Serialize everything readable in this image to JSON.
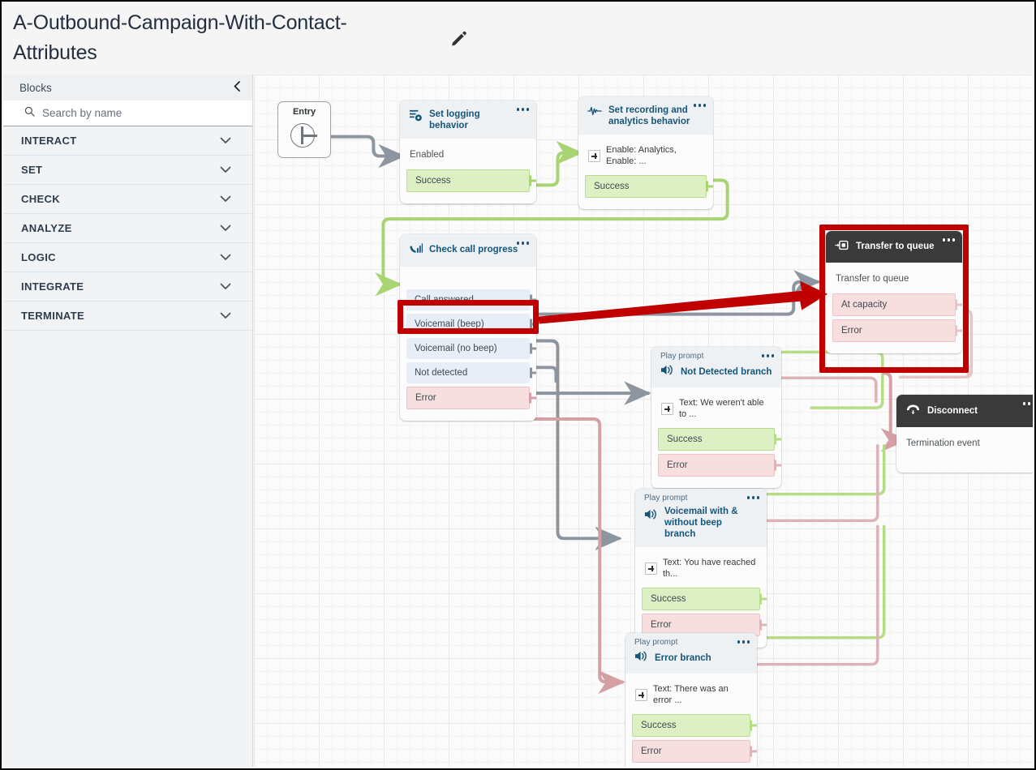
{
  "header": {
    "title": "A-Outbound-Campaign-With-Contact-Attributes",
    "edit_icon": "pencil-icon"
  },
  "sidebar": {
    "panel_title": "Blocks",
    "collapse_icon": "chevron-left-icon",
    "search": {
      "placeholder": "Search by name",
      "icon": "search-icon",
      "value": ""
    },
    "categories": [
      {
        "label": "INTERACT",
        "icon": "chevron-down-icon"
      },
      {
        "label": "SET",
        "icon": "chevron-down-icon"
      },
      {
        "label": "CHECK",
        "icon": "chevron-down-icon"
      },
      {
        "label": "ANALYZE",
        "icon": "chevron-down-icon"
      },
      {
        "label": "LOGIC",
        "icon": "chevron-down-icon"
      },
      {
        "label": "INTEGRATE",
        "icon": "chevron-down-icon"
      },
      {
        "label": "TERMINATE",
        "icon": "chevron-down-icon"
      }
    ]
  },
  "canvas": {
    "entry": {
      "label": "Entry"
    },
    "blocks": {
      "set_logging": {
        "title": "Set logging behavior",
        "icon": "log-settings-icon",
        "menu_icon": "more-options-icon",
        "input_label": "Enabled",
        "ports": [
          {
            "label": "Success",
            "type": "green"
          }
        ]
      },
      "set_recording": {
        "title": "Set recording and analytics behavior",
        "icon": "waveform-icon",
        "menu_icon": "more-options-icon",
        "param_label": "Enable: Analytics, Enable: ...",
        "ports": [
          {
            "label": "Success",
            "type": "green"
          }
        ]
      },
      "check_call_progress": {
        "title": "Check call progress",
        "icon": "call-progress-icon",
        "menu_icon": "more-options-icon",
        "ports": [
          {
            "label": "Call answered",
            "type": "blue"
          },
          {
            "label": "Voicemail (beep)",
            "type": "blue"
          },
          {
            "label": "Voicemail (no beep)",
            "type": "blue"
          },
          {
            "label": "Not detected",
            "type": "blue"
          },
          {
            "label": "Error",
            "type": "red"
          }
        ]
      },
      "transfer_to_queue": {
        "title": "Transfer to queue",
        "icon": "transfer-queue-icon",
        "menu_icon": "more-options-icon",
        "input_label": "Transfer to queue",
        "ports": [
          {
            "label": "At capacity",
            "type": "red"
          },
          {
            "label": "Error",
            "type": "red"
          }
        ]
      },
      "not_detected_branch": {
        "subtitle": "Play prompt",
        "title": "Not Detected branch",
        "icon": "speaker-icon",
        "menu_icon": "more-options-icon",
        "param_label": "Text: We weren't able to ...",
        "ports": [
          {
            "label": "Success",
            "type": "green"
          },
          {
            "label": "Error",
            "type": "red"
          }
        ]
      },
      "voicemail_branch": {
        "subtitle": "Play prompt",
        "title": "Voicemail with & without beep branch",
        "icon": "speaker-icon",
        "menu_icon": "more-options-icon",
        "param_label": "Text: You have reached th...",
        "ports": [
          {
            "label": "Success",
            "type": "green"
          },
          {
            "label": "Error",
            "type": "red"
          }
        ]
      },
      "error_branch": {
        "subtitle": "Play prompt",
        "title": "Error branch",
        "icon": "speaker-icon",
        "menu_icon": "more-options-icon",
        "param_label": "Text: There was an error ...",
        "ports": [
          {
            "label": "Success",
            "type": "green"
          },
          {
            "label": "Error",
            "type": "red"
          }
        ]
      },
      "disconnect": {
        "title": "Disconnect",
        "icon": "hangup-icon",
        "menu_icon": "more-options-icon",
        "input_label": "Termination event"
      }
    },
    "annotations": {
      "highlight_color": "#c00000",
      "highlighted": [
        "Call answered",
        "Transfer to queue"
      ],
      "arrow": "call-answered-to-transfer-to-queue"
    }
  },
  "colors": {
    "success": "#dcf0c4",
    "error": "#f7dfe0",
    "branch": "#e7eef7",
    "title_blue": "#16557a",
    "dark_header": "#3a3a3a",
    "annotation_red": "#c00000"
  }
}
